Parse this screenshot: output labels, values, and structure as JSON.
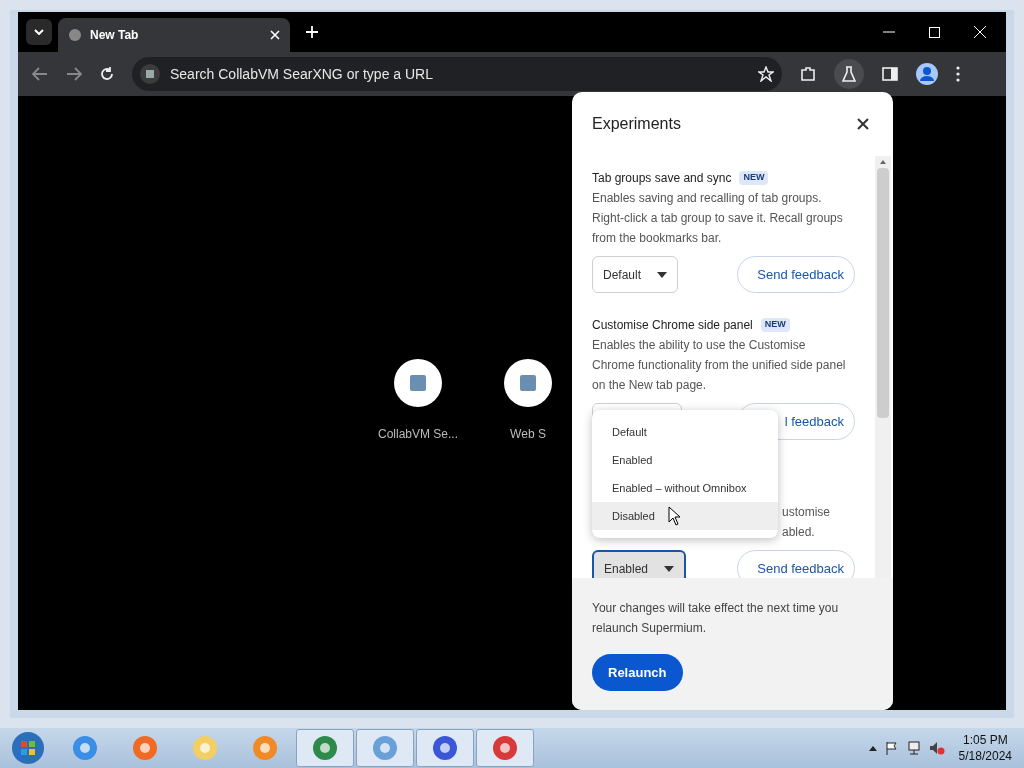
{
  "browser": {
    "tab": {
      "title": "New Tab",
      "selected": true
    },
    "omnibox": {
      "placeholder": "Search CollabVM SearXNG or type a URL"
    }
  },
  "shortcuts": [
    {
      "title": "CollabVM Se..."
    },
    {
      "title": "Web S"
    }
  ],
  "experiments_panel": {
    "title": "Experiments",
    "items": [
      {
        "kind": "full",
        "name": "Tab groups save and sync",
        "badge": "NEW",
        "description": "Enables saving and recalling of tab groups. Right-click a tab group to save it. Recall groups from the bookmarks bar.",
        "select_value": "Default",
        "focused": false,
        "feedback": "Send feedback"
      },
      {
        "kind": "covered",
        "name": "Customise Chrome side panel",
        "badge": "NEW",
        "description": "Enables the ability to use the Customise Chrome functionality from the unified side panel on the New tab page.",
        "feedback": "l feedback"
      },
      {
        "kind": "tail",
        "description_lines": [
          "ustomise",
          "abled."
        ],
        "select_value": "Enabled",
        "focused": true,
        "feedback": "Send feedback"
      }
    ],
    "dropdown": {
      "options": [
        {
          "label": "Default",
          "hovered": false
        },
        {
          "label": "Enabled",
          "hovered": false
        },
        {
          "label": "Enabled – without Omnibox",
          "hovered": false
        },
        {
          "label": "Disabled",
          "hovered": true
        }
      ]
    },
    "notice": "Your changes will take effect the next time you relaunch Supermium.",
    "relaunch": "Relaunch"
  },
  "taskbar": {
    "clock": {
      "time": "1:05 PM",
      "date": "5/18/2024"
    }
  }
}
